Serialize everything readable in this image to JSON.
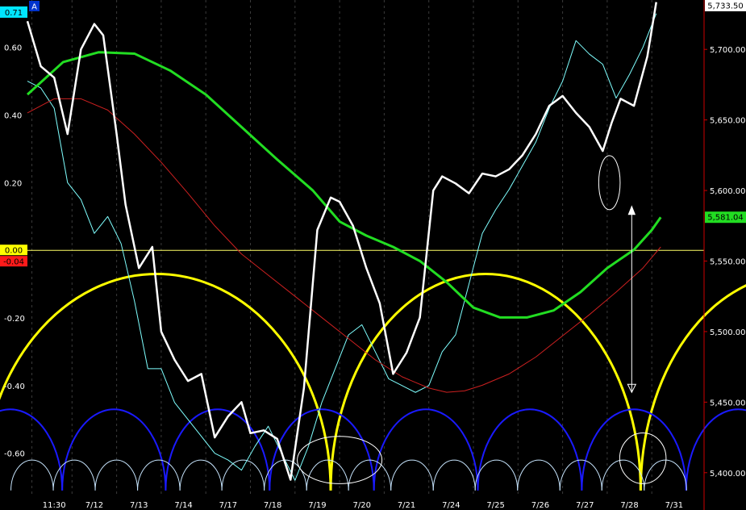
{
  "chart_data": {
    "type": "line",
    "panel_tag": "A",
    "left_axis": {
      "ticks": [
        "0.60",
        "0.40",
        "0.20",
        "-0.20",
        "-0.40",
        "-0.60"
      ],
      "tick_values": [
        0.6,
        0.4,
        0.2,
        -0.2,
        -0.4,
        -0.6
      ],
      "ylim": [
        -0.72,
        0.74
      ]
    },
    "right_axis": {
      "ticks": [
        "5,700.00",
        "5,650.00",
        "5,600.00",
        "5,550.00",
        "5,500.00",
        "5,450.00",
        "5,400.00"
      ],
      "tick_values": [
        5700,
        5650,
        5600,
        5550,
        5500,
        5450,
        5400
      ],
      "ylim": [
        5385,
        5735
      ]
    },
    "x_ticks": [
      "11:30",
      "7/12",
      "7/13",
      "7/14",
      "7/17",
      "7/18",
      "7/19",
      "7/20",
      "7/21",
      "7/24",
      "7/25",
      "7/26",
      "7/27",
      "7/28",
      "7/31"
    ],
    "x_index": [
      0.6,
      1.5,
      2.5,
      3.5,
      4.5,
      5.5,
      6.5,
      7.5,
      8.5,
      9.5,
      10.5,
      11.5,
      12.5,
      13.5,
      14.5
    ],
    "badges": {
      "top_left": {
        "text": "0.71",
        "color": "#00e5ff"
      },
      "zero": {
        "text": "0.00",
        "color": "#ffff00"
      },
      "neg": {
        "text": "-0.04",
        "color": "#ff1a1a"
      },
      "last_price": {
        "text": "5,733.50",
        "color": "#ffffff"
      },
      "ma_value": {
        "text": "5,581.04",
        "color": "#22dd22"
      }
    },
    "zero_line_value": 0.0,
    "series": [
      {
        "color": "#ffffff",
        "axis": "right",
        "x": [
          0,
          0.3,
          0.6,
          0.9,
          1.2,
          1.5,
          1.7,
          2.0,
          2.2,
          2.5,
          2.8,
          3.0,
          3.3,
          3.6,
          3.9,
          4.2,
          4.5,
          4.8,
          5.0,
          5.3,
          5.6,
          5.9,
          6.2,
          6.5,
          6.8,
          7.0,
          7.3,
          7.6,
          7.9,
          8.2,
          8.5,
          8.8,
          9.1,
          9.3,
          9.6,
          9.9,
          10.2,
          10.5,
          10.8,
          11.1,
          11.4,
          11.7,
          12.0,
          12.3,
          12.6,
          12.9,
          13.1,
          13.3,
          13.6,
          13.9,
          14.1
        ],
        "values": [
          5720,
          5688,
          5680,
          5640,
          5700,
          5718,
          5710,
          5640,
          5590,
          5545,
          5560,
          5500,
          5480,
          5465,
          5470,
          5425,
          5440,
          5450,
          5428,
          5430,
          5424,
          5395,
          5460,
          5572,
          5595,
          5592,
          5575,
          5545,
          5520,
          5470,
          5485,
          5510,
          5600,
          5610,
          5605,
          5598,
          5612,
          5610,
          5615,
          5625,
          5640,
          5660,
          5667,
          5655,
          5645,
          5628,
          5648,
          5665,
          5660,
          5695,
          5733.5
        ]
      },
      {
        "color": "#7fffff",
        "axis": "left",
        "x": [
          0,
          0.3,
          0.6,
          0.9,
          1.2,
          1.5,
          1.8,
          2.1,
          2.4,
          2.7,
          3.0,
          3.3,
          3.6,
          3.9,
          4.2,
          4.5,
          4.8,
          5.1,
          5.4,
          5.7,
          6.0,
          6.3,
          6.6,
          6.9,
          7.2,
          7.5,
          7.8,
          8.1,
          8.4,
          8.7,
          9.0,
          9.3,
          9.6,
          9.9,
          10.2,
          10.5,
          10.8,
          11.1,
          11.4,
          11.7,
          12.0,
          12.3,
          12.6,
          12.9,
          13.2,
          13.5,
          13.8,
          14.1
        ],
        "values": [
          0.5,
          0.48,
          0.42,
          0.2,
          0.15,
          0.05,
          0.1,
          0.02,
          -0.15,
          -0.35,
          -0.35,
          -0.45,
          -0.5,
          -0.55,
          -0.6,
          -0.62,
          -0.65,
          -0.58,
          -0.52,
          -0.6,
          -0.68,
          -0.58,
          -0.45,
          -0.35,
          -0.25,
          -0.22,
          -0.3,
          -0.38,
          -0.4,
          -0.42,
          -0.4,
          -0.3,
          -0.25,
          -0.1,
          0.05,
          0.12,
          0.18,
          0.25,
          0.32,
          0.42,
          0.5,
          0.62,
          0.58,
          0.55,
          0.45,
          0.52,
          0.6,
          0.7
        ]
      },
      {
        "color": "#22dd22",
        "axis": "right",
        "x": [
          0,
          0.8,
          1.6,
          2.4,
          3.2,
          4.0,
          4.8,
          5.6,
          6.4,
          7.0,
          7.6,
          8.2,
          8.8,
          9.4,
          10.0,
          10.6,
          11.2,
          11.8,
          12.4,
          13.0,
          13.6,
          14.0,
          14.2
        ],
        "values": [
          5668,
          5691,
          5698,
          5697,
          5685,
          5668,
          5645,
          5622,
          5600,
          5578,
          5568,
          5560,
          5550,
          5535,
          5517,
          5510,
          5510,
          5515,
          5528,
          5545,
          5558,
          5572,
          5581.04
        ]
      },
      {
        "color": "#cc2020",
        "axis": "right",
        "x": [
          0,
          0.6,
          1.2,
          1.8,
          2.4,
          3.0,
          3.6,
          4.2,
          4.8,
          5.4,
          6.0,
          6.6,
          7.2,
          7.8,
          8.4,
          9.0,
          9.4,
          9.8,
          10.2,
          10.8,
          11.4,
          12.0,
          12.6,
          13.2,
          13.8,
          14.2
        ],
        "values": [
          5655,
          5665,
          5665,
          5657,
          5640,
          5620,
          5598,
          5575,
          5555,
          5540,
          5525,
          5510,
          5495,
          5480,
          5468,
          5460,
          5457,
          5458,
          5462,
          5470,
          5482,
          5497,
          5512,
          5528,
          5545,
          5560
        ]
      }
    ],
    "cycles": [
      {
        "color": "#ffff00",
        "lows_x": [
          -1,
          6.8,
          13.75,
          20.7
        ],
        "peak_value": -0.07,
        "trough_value": -0.71
      },
      {
        "color": "#1a1aff",
        "lows_x": [
          -1.55,
          0.78,
          3.1,
          5.43,
          7.77,
          10.1,
          12.43,
          14.77,
          17.1
        ],
        "peak_value": -0.47,
        "trough_value": -0.71
      },
      {
        "color": "#c8e6ff",
        "lows_x": [
          -0.37,
          0.58,
          1.52,
          2.47,
          3.42,
          4.36,
          5.31,
          6.26,
          7.2,
          8.15,
          9.1,
          10.04,
          10.99,
          11.94,
          12.88,
          13.83,
          14.78
        ],
        "peak_value": -0.62,
        "trough_value": -0.71
      }
    ],
    "annotations": {
      "ellipses": [
        {
          "x": 13.05,
          "y": 0.2,
          "rx": 0.24,
          "ry": 0.08
        },
        {
          "x": 7.0,
          "y": -0.62,
          "rx": 0.95,
          "ry": 0.07
        },
        {
          "x": 13.8,
          "y": -0.615,
          "rx": 0.52,
          "ry": 0.075
        }
      ],
      "arrow_line": {
        "x": 13.55,
        "y_top": 0.13,
        "y_bottom": -0.42
      }
    }
  }
}
